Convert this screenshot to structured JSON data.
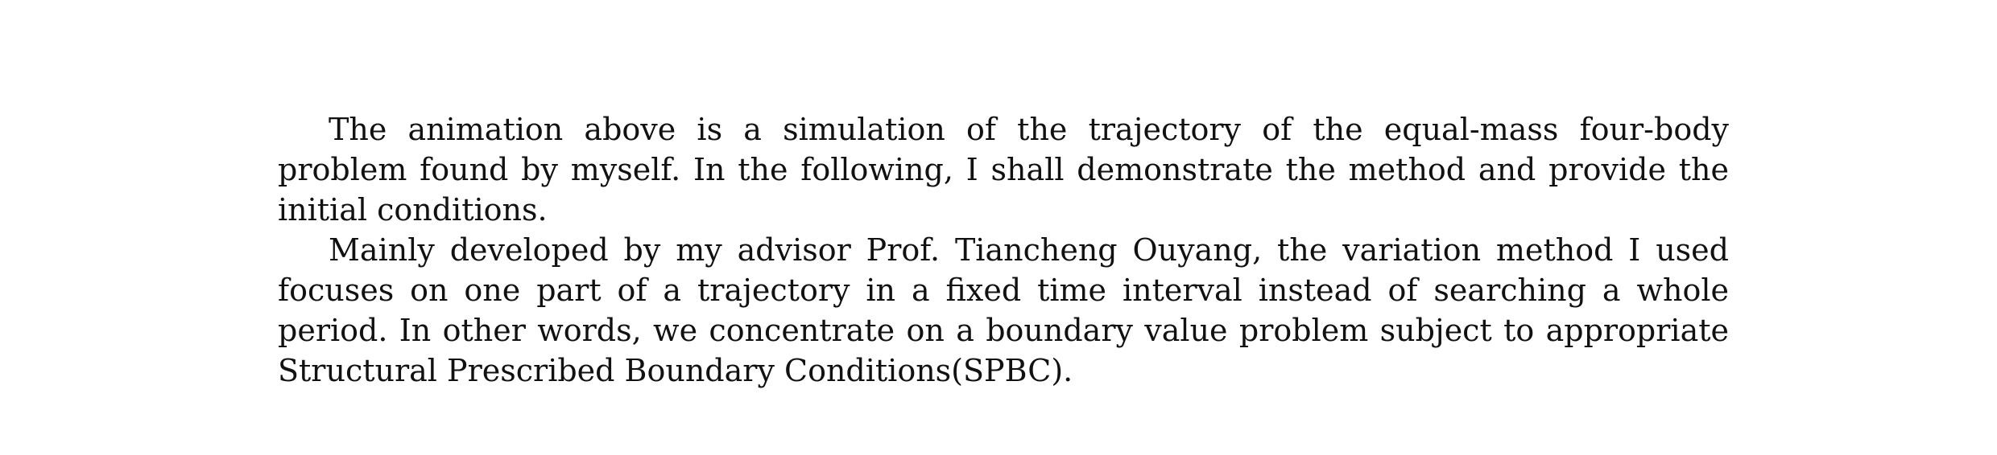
{
  "paragraphs": [
    "The animation above is a simulation of the trajectory of the equal-mass four-body problem found by myself. In the following, I shall demonstrate the method and provide the initial conditions.",
    "Mainly developed by my advisor Prof. Tiancheng Ouyang, the variation method I used focuses on one part of a trajectory in a fixed time interval instead of searching a whole period. In other words, we concentrate on a boundary value problem subject to appropriate Structural Prescribed Boundary Conditions(SPBC)."
  ]
}
